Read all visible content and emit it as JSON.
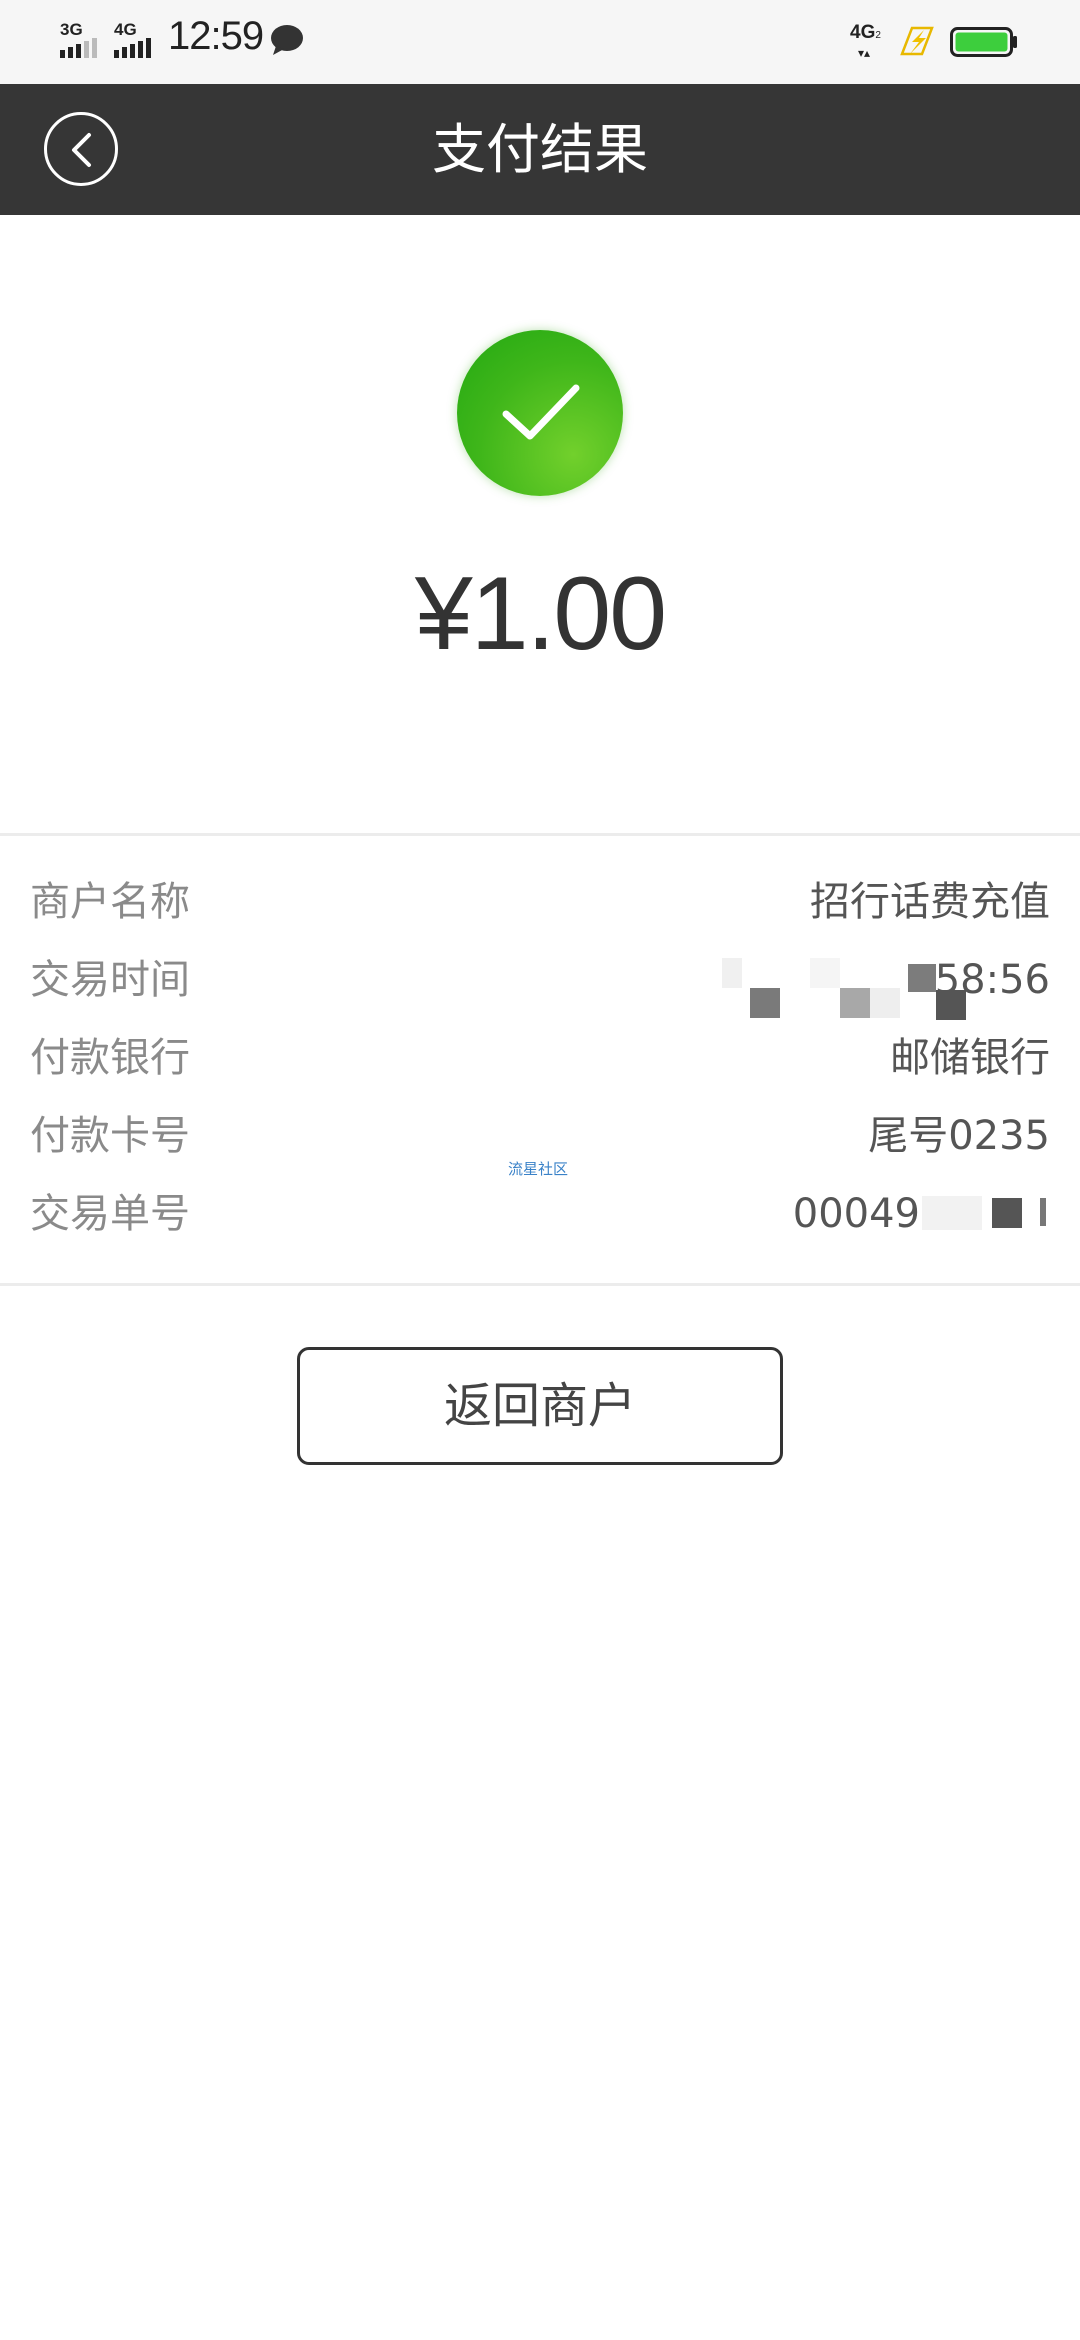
{
  "status_bar": {
    "sim1_label": "3G",
    "sim2_label": "4G",
    "time": "12:59",
    "network_label": "4G",
    "network_sub": "2",
    "battery_color": "#3dce3d"
  },
  "header": {
    "title": "支付结果"
  },
  "payment": {
    "amount": "¥1.00",
    "success_color": "#3fb61a"
  },
  "details": [
    {
      "label": "商户名称",
      "value": "招行话费充值"
    },
    {
      "label": "交易时间",
      "value": "58:56"
    },
    {
      "label": "付款银行",
      "value": "邮储银行"
    },
    {
      "label": "付款卡号",
      "value": "尾号0235"
    },
    {
      "label": "交易单号",
      "value": "00049"
    }
  ],
  "watermark": "流星社区",
  "actions": {
    "return_label": "返回商户"
  }
}
